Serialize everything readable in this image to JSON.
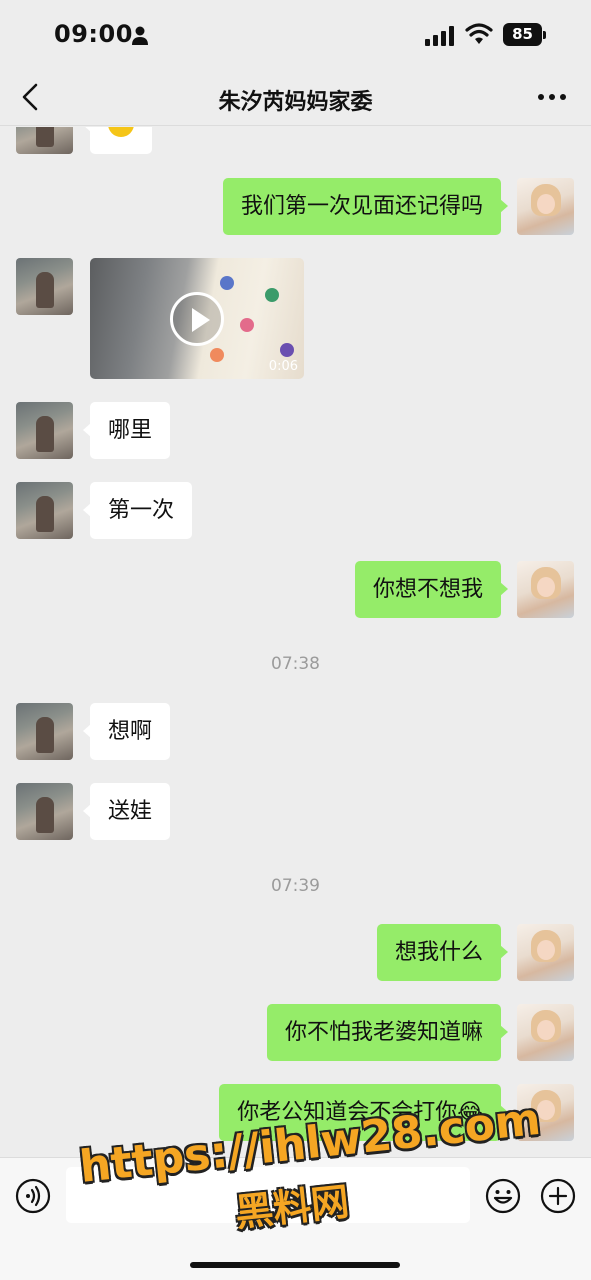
{
  "status_bar": {
    "time": "09:00",
    "battery": "85"
  },
  "nav": {
    "title": "朱汐芮妈妈家委"
  },
  "messages": {
    "m1": "我们第一次见面还记得吗",
    "video_duration": "0:06",
    "m3": "哪里",
    "m4": "第一次",
    "m5": "你想不想我",
    "ts1": "07:38",
    "m6": "想啊",
    "m7": "送娃",
    "ts2": "07:39",
    "m8": "想我什么",
    "m9": "你不怕我老婆知道嘛",
    "m10": "你老公知道会不会打你😂"
  },
  "input": {
    "placeholder": ""
  },
  "watermark": {
    "url": "https://ihlw28.com",
    "name": "黑料网"
  },
  "colors": {
    "self_bubble": "#95ec69",
    "other_bubble": "#ffffff",
    "background": "#ededed"
  }
}
